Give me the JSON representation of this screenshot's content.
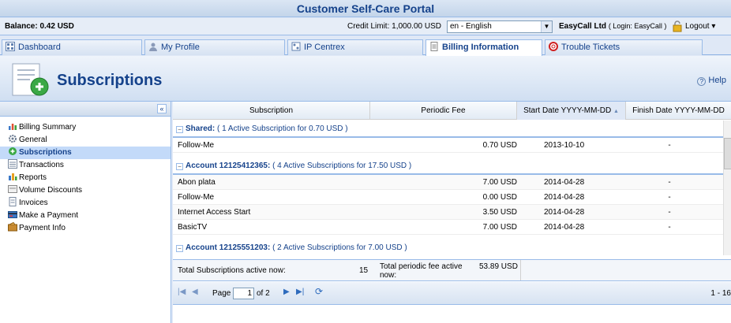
{
  "app": {
    "title": "Customer Self-Care Portal"
  },
  "infobar": {
    "balance": "Balance: 0.42 USD",
    "credit_limit_label": "Credit Limit:",
    "credit_limit_value": "1,000.00 USD",
    "language": "en - English",
    "company": "EasyCall Ltd",
    "login": "( Login: EasyCall )",
    "logout": "Logout"
  },
  "tabs": [
    {
      "label": "Dashboard"
    },
    {
      "label": "My Profile"
    },
    {
      "label": "IP Centrex"
    },
    {
      "label": "Billing Information"
    },
    {
      "label": "Trouble Tickets"
    }
  ],
  "page": {
    "title": "Subscriptions",
    "help": "Help"
  },
  "sidebar": {
    "collapse_label": "«",
    "items": [
      {
        "label": "Billing Summary"
      },
      {
        "label": "General"
      },
      {
        "label": "Subscriptions"
      },
      {
        "label": "Transactions"
      },
      {
        "label": "Reports"
      },
      {
        "label": "Volume Discounts"
      },
      {
        "label": "Invoices"
      },
      {
        "label": "Make a Payment"
      },
      {
        "label": "Payment Info"
      }
    ]
  },
  "grid": {
    "columns": [
      "Subscription",
      "Periodic Fee",
      "Start Date YYYY-MM-DD",
      "Finish Date YYYY-MM-DD"
    ],
    "groups": [
      {
        "name": "Shared:",
        "summary": "( 1 Active Subscription for 0.70 USD )",
        "rows": [
          {
            "subscription": "Follow-Me",
            "fee": "0.70 USD",
            "start": "2013-10-10",
            "finish": "-"
          }
        ]
      },
      {
        "name": "Account 12125412365:",
        "summary": "( 4 Active Subscriptions for 17.50 USD )",
        "rows": [
          {
            "subscription": "Abon plata",
            "fee": "7.00 USD",
            "start": "2014-04-28",
            "finish": "-"
          },
          {
            "subscription": "Follow-Me",
            "fee": "0.00 USD",
            "start": "2014-04-28",
            "finish": "-"
          },
          {
            "subscription": "Internet Access Start",
            "fee": "3.50 USD",
            "start": "2014-04-28",
            "finish": "-"
          },
          {
            "subscription": "BasicTV",
            "fee": "7.00 USD",
            "start": "2014-04-28",
            "finish": "-"
          }
        ]
      },
      {
        "name": "Account 12125551203:",
        "summary": "( 2 Active Subscriptions for 7.00 USD )",
        "rows": []
      }
    ],
    "footer": {
      "total_subs_label": "Total Subscriptions active now:",
      "total_subs_value": "15",
      "total_fee_label": "Total periodic fee active now:",
      "total_fee_value": "53.89 USD"
    },
    "pager": {
      "page_label": "Page",
      "page_value": "1",
      "of_label": "of 2",
      "count": "1 - 16"
    }
  }
}
